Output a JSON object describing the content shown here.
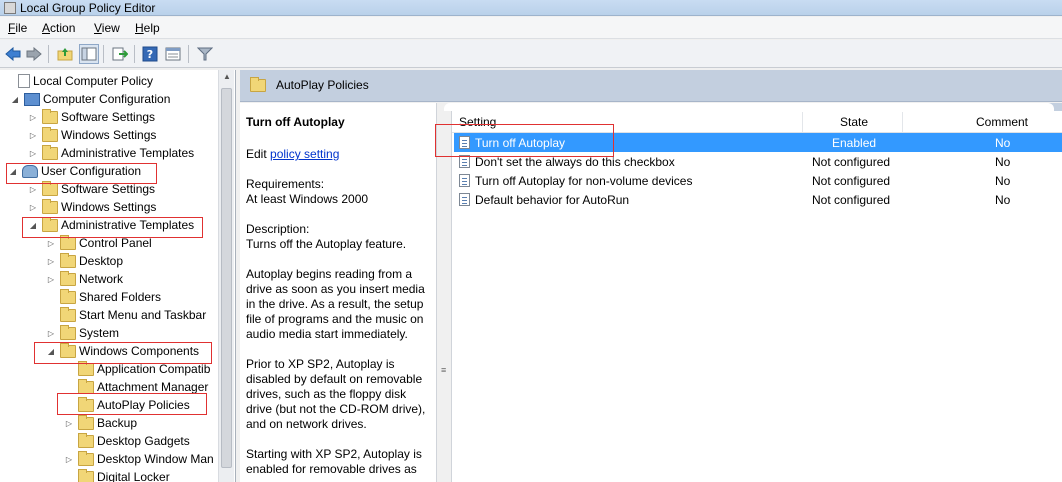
{
  "window": {
    "title": "Local Group Policy Editor"
  },
  "menu": [
    {
      "label": "File",
      "accel": "F",
      "rest": "ile"
    },
    {
      "label": "Action",
      "accel": "A",
      "rest": "ction"
    },
    {
      "label": "View",
      "accel": "V",
      "rest": "iew"
    },
    {
      "label": "Help",
      "accel": "H",
      "rest": "elp"
    }
  ],
  "toolbar_icons": [
    "back-arrow-icon",
    "forward-arrow-icon",
    "up-folder-icon",
    "show-hide-tree-icon",
    "export-list-icon",
    "help-icon",
    "properties-icon",
    "filter-icon"
  ],
  "tree": [
    {
      "label": "Local Computer Policy",
      "icon": "policy-doc-icon",
      "expander": ""
    },
    {
      "label": "Computer Configuration",
      "icon": "computer-icon",
      "expander": "expanded"
    },
    {
      "label": "Software Settings",
      "icon": "folder-icon",
      "expander": "collapsed"
    },
    {
      "label": "Windows Settings",
      "icon": "folder-icon",
      "expander": "collapsed"
    },
    {
      "label": "Administrative Templates",
      "icon": "folder-icon",
      "expander": "collapsed"
    },
    {
      "label": "User Configuration",
      "icon": "user-icon",
      "expander": "expanded"
    },
    {
      "label": "Software Settings",
      "icon": "folder-icon",
      "expander": "collapsed"
    },
    {
      "label": "Windows Settings",
      "icon": "folder-icon",
      "expander": "collapsed"
    },
    {
      "label": "Administrative Templates",
      "icon": "folder-icon",
      "expander": "expanded"
    },
    {
      "label": "Control Panel",
      "icon": "folder-icon",
      "expander": "collapsed"
    },
    {
      "label": "Desktop",
      "icon": "folder-icon",
      "expander": "collapsed"
    },
    {
      "label": "Network",
      "icon": "folder-icon",
      "expander": "collapsed"
    },
    {
      "label": "Shared Folders",
      "icon": "folder-icon",
      "expander": ""
    },
    {
      "label": "Start Menu and Taskbar",
      "icon": "folder-icon",
      "expander": ""
    },
    {
      "label": "System",
      "icon": "folder-icon",
      "expander": "collapsed"
    },
    {
      "label": "Windows Components",
      "icon": "folder-icon",
      "expander": "expanded"
    },
    {
      "label": "Application Compatib",
      "icon": "folder-icon",
      "expander": ""
    },
    {
      "label": "Attachment Manager",
      "icon": "folder-icon",
      "expander": ""
    },
    {
      "label": "AutoPlay Policies",
      "icon": "folder-icon",
      "expander": ""
    },
    {
      "label": "Backup",
      "icon": "folder-icon",
      "expander": "collapsed"
    },
    {
      "label": "Desktop Gadgets",
      "icon": "folder-icon",
      "expander": ""
    },
    {
      "label": "Desktop Window Man",
      "icon": "folder-icon",
      "expander": "collapsed"
    },
    {
      "label": "Digital Locker",
      "icon": "folder-icon",
      "expander": ""
    }
  ],
  "header": {
    "title": "AutoPlay Policies"
  },
  "description": {
    "title": "Turn off Autoplay",
    "edit_prefix": "Edit ",
    "edit_link": "policy setting",
    "requirements_label": "Requirements:",
    "requirements_value": "At least Windows 2000",
    "description_label": "Description:",
    "description_value": "Turns off the Autoplay feature.",
    "para1": "Autoplay begins reading from a drive as soon as you insert media in the drive. As a result, the setup file of programs and the music on audio media start immediately.",
    "para2": "Prior to XP SP2, Autoplay is disabled by default on removable drives, such as the floppy disk drive (but not the CD-ROM drive), and on network drives.",
    "para3": "Starting with XP SP2, Autoplay is enabled for removable drives as"
  },
  "list": {
    "columns": {
      "setting": "Setting",
      "state": "State",
      "comment": "Comment"
    },
    "rows": [
      {
        "setting": "Turn off Autoplay",
        "state": "Enabled",
        "comment": "No",
        "selected": true
      },
      {
        "setting": "Don't set the always do this checkbox",
        "state": "Not configured",
        "comment": "No",
        "selected": false
      },
      {
        "setting": "Turn off Autoplay for non-volume devices",
        "state": "Not configured",
        "comment": "No",
        "selected": false
      },
      {
        "setting": "Default behavior for AutoRun",
        "state": "Not configured",
        "comment": "No",
        "selected": false
      }
    ]
  },
  "colors": {
    "selection": "#3399ff",
    "highlight_box": "#e03131",
    "header_bg": "#c3cfdf"
  }
}
